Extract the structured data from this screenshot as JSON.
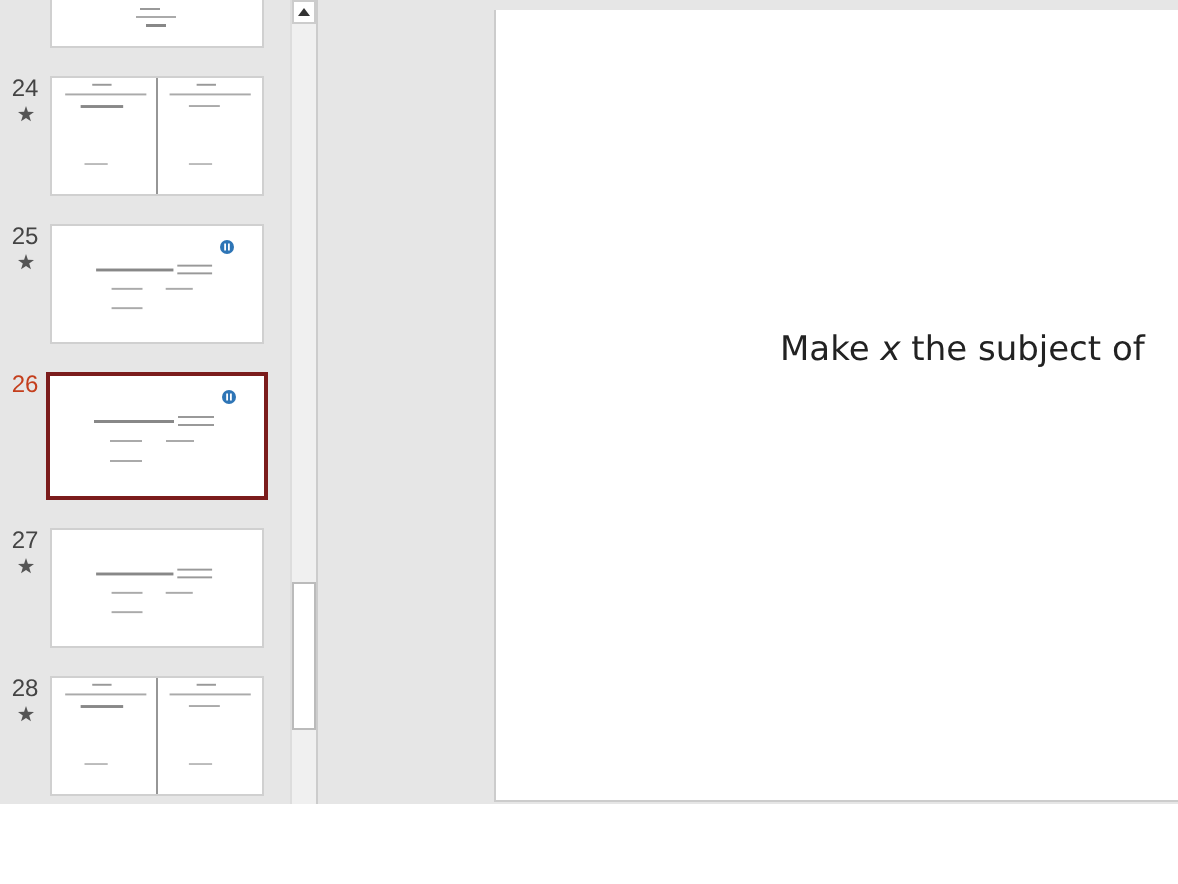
{
  "slides": [
    {
      "kind": "cropped",
      "starred": false,
      "selected": false
    },
    {
      "number": "24",
      "kind": "split",
      "starred": true,
      "selected": false
    },
    {
      "number": "25",
      "kind": "single",
      "starred": true,
      "selected": false,
      "badge": true
    },
    {
      "number": "26",
      "kind": "single",
      "starred": false,
      "selected": true,
      "badge": true
    },
    {
      "number": "27",
      "kind": "single",
      "starred": true,
      "selected": false
    },
    {
      "number": "28",
      "kind": "split",
      "starred": true,
      "selected": false
    }
  ],
  "editor": {
    "slide_text": "Make *x* the subject of"
  }
}
